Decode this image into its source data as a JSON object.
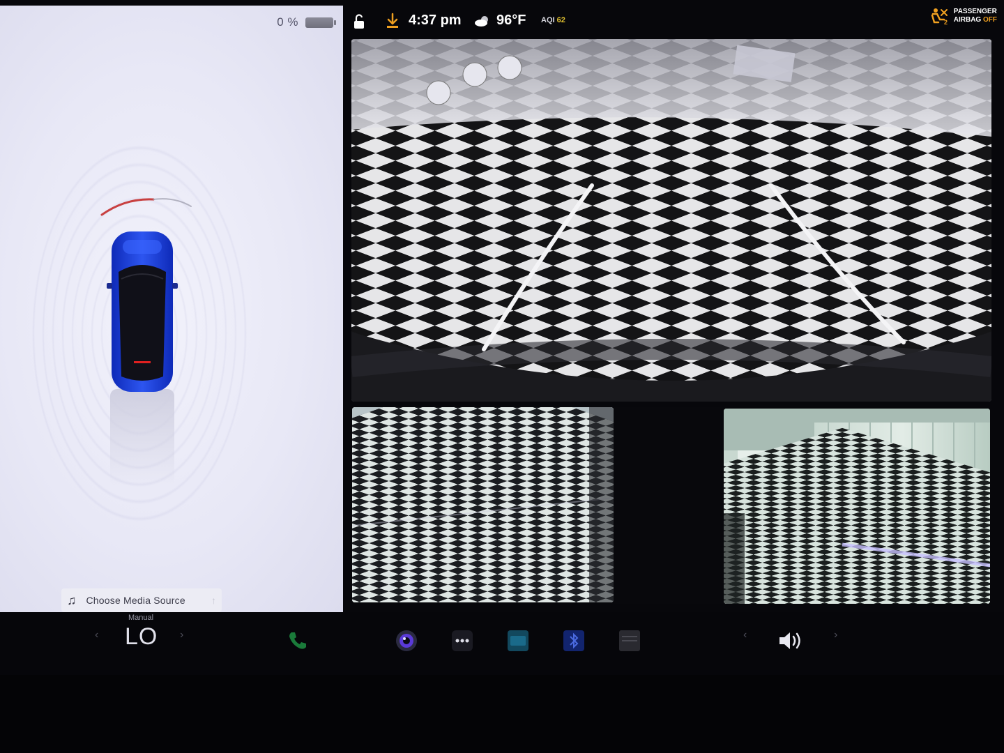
{
  "left_panel": {
    "battery_percent": "0 %",
    "media": {
      "label": "Choose Media Source",
      "note_icon": "music-note-icon",
      "up_icon": "arrow-up-icon"
    },
    "car_color": "#1b3fd8",
    "sensor_arc_color": "#c84040"
  },
  "status_bar": {
    "lock_icon": "unlock-icon",
    "download_icon": "download-icon",
    "time": "4:37 pm",
    "weather_icon": "partly-cloudy-icon",
    "temperature": "96°F",
    "aqi_label": "AQI",
    "aqi_value": "62",
    "airbag": {
      "line1": "PASSENGER",
      "line2_prefix": "AIRBAG",
      "line2_status": "OFF",
      "icon": "passenger-airbag-icon",
      "status_color": "#f0a020"
    },
    "download_color": "#f0a020"
  },
  "cameras": {
    "main": "rear-camera-view",
    "left": "left-repeater-camera-view",
    "right": "right-repeater-camera-view"
  },
  "dock": {
    "climate_mode": "Manual",
    "climate_temp": "LO",
    "climate_prev": "‹",
    "climate_next": "›",
    "volume_prev": "‹",
    "volume_next": "›",
    "icons": [
      "phone-icon",
      "camera-app-icon",
      "more-apps-icon",
      "toybox-icon",
      "bluetooth-icon",
      "calendar-icon",
      "volume-icon"
    ]
  }
}
